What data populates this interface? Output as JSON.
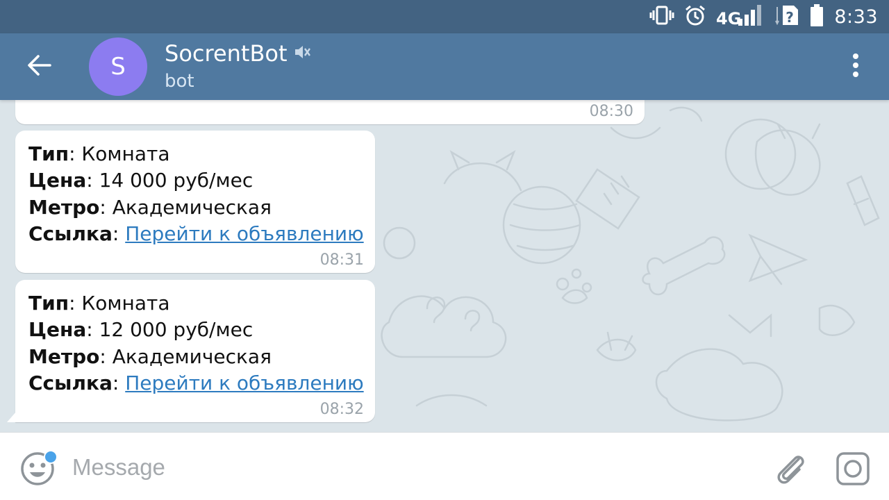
{
  "status_bar": {
    "network_label": "4G",
    "time": "8:33",
    "icons": [
      "vibrate-icon",
      "alarm-icon",
      "signal-icon",
      "no-sim-icon",
      "battery-icon"
    ]
  },
  "header": {
    "avatar_letter": "S",
    "avatar_color": "#8c7cf0",
    "title": "SocrentBot",
    "subtitle": "bot",
    "header_color": "#5079a0",
    "status_bar_color": "#436382",
    "icons": [
      "back-arrow-icon",
      "muted-icon",
      "more-vertical-icon"
    ]
  },
  "messages": [
    {
      "time": "08:30"
    },
    {
      "type_label": "Тип",
      "type_value": "Комната",
      "price_label": "Цена",
      "price_value": "14 000 руб/мес",
      "metro_label": "Метро",
      "metro_value": "Академическая",
      "link_label": "Ссылка",
      "link_text": "Перейти к объявлению",
      "time": "08:31"
    },
    {
      "type_label": "Тип",
      "type_value": "Комната",
      "price_label": "Цена",
      "price_value": "12 000 руб/мес",
      "metro_label": "Метро",
      "metro_value": "Академическая",
      "link_label": "Ссылка",
      "link_text": "Перейти к объявлению",
      "time": "08:32"
    }
  ],
  "input_bar": {
    "placeholder": "Message",
    "link_color": "#2d7bbf",
    "icons": [
      "emoji-icon",
      "attach-icon",
      "camera-icon"
    ]
  }
}
